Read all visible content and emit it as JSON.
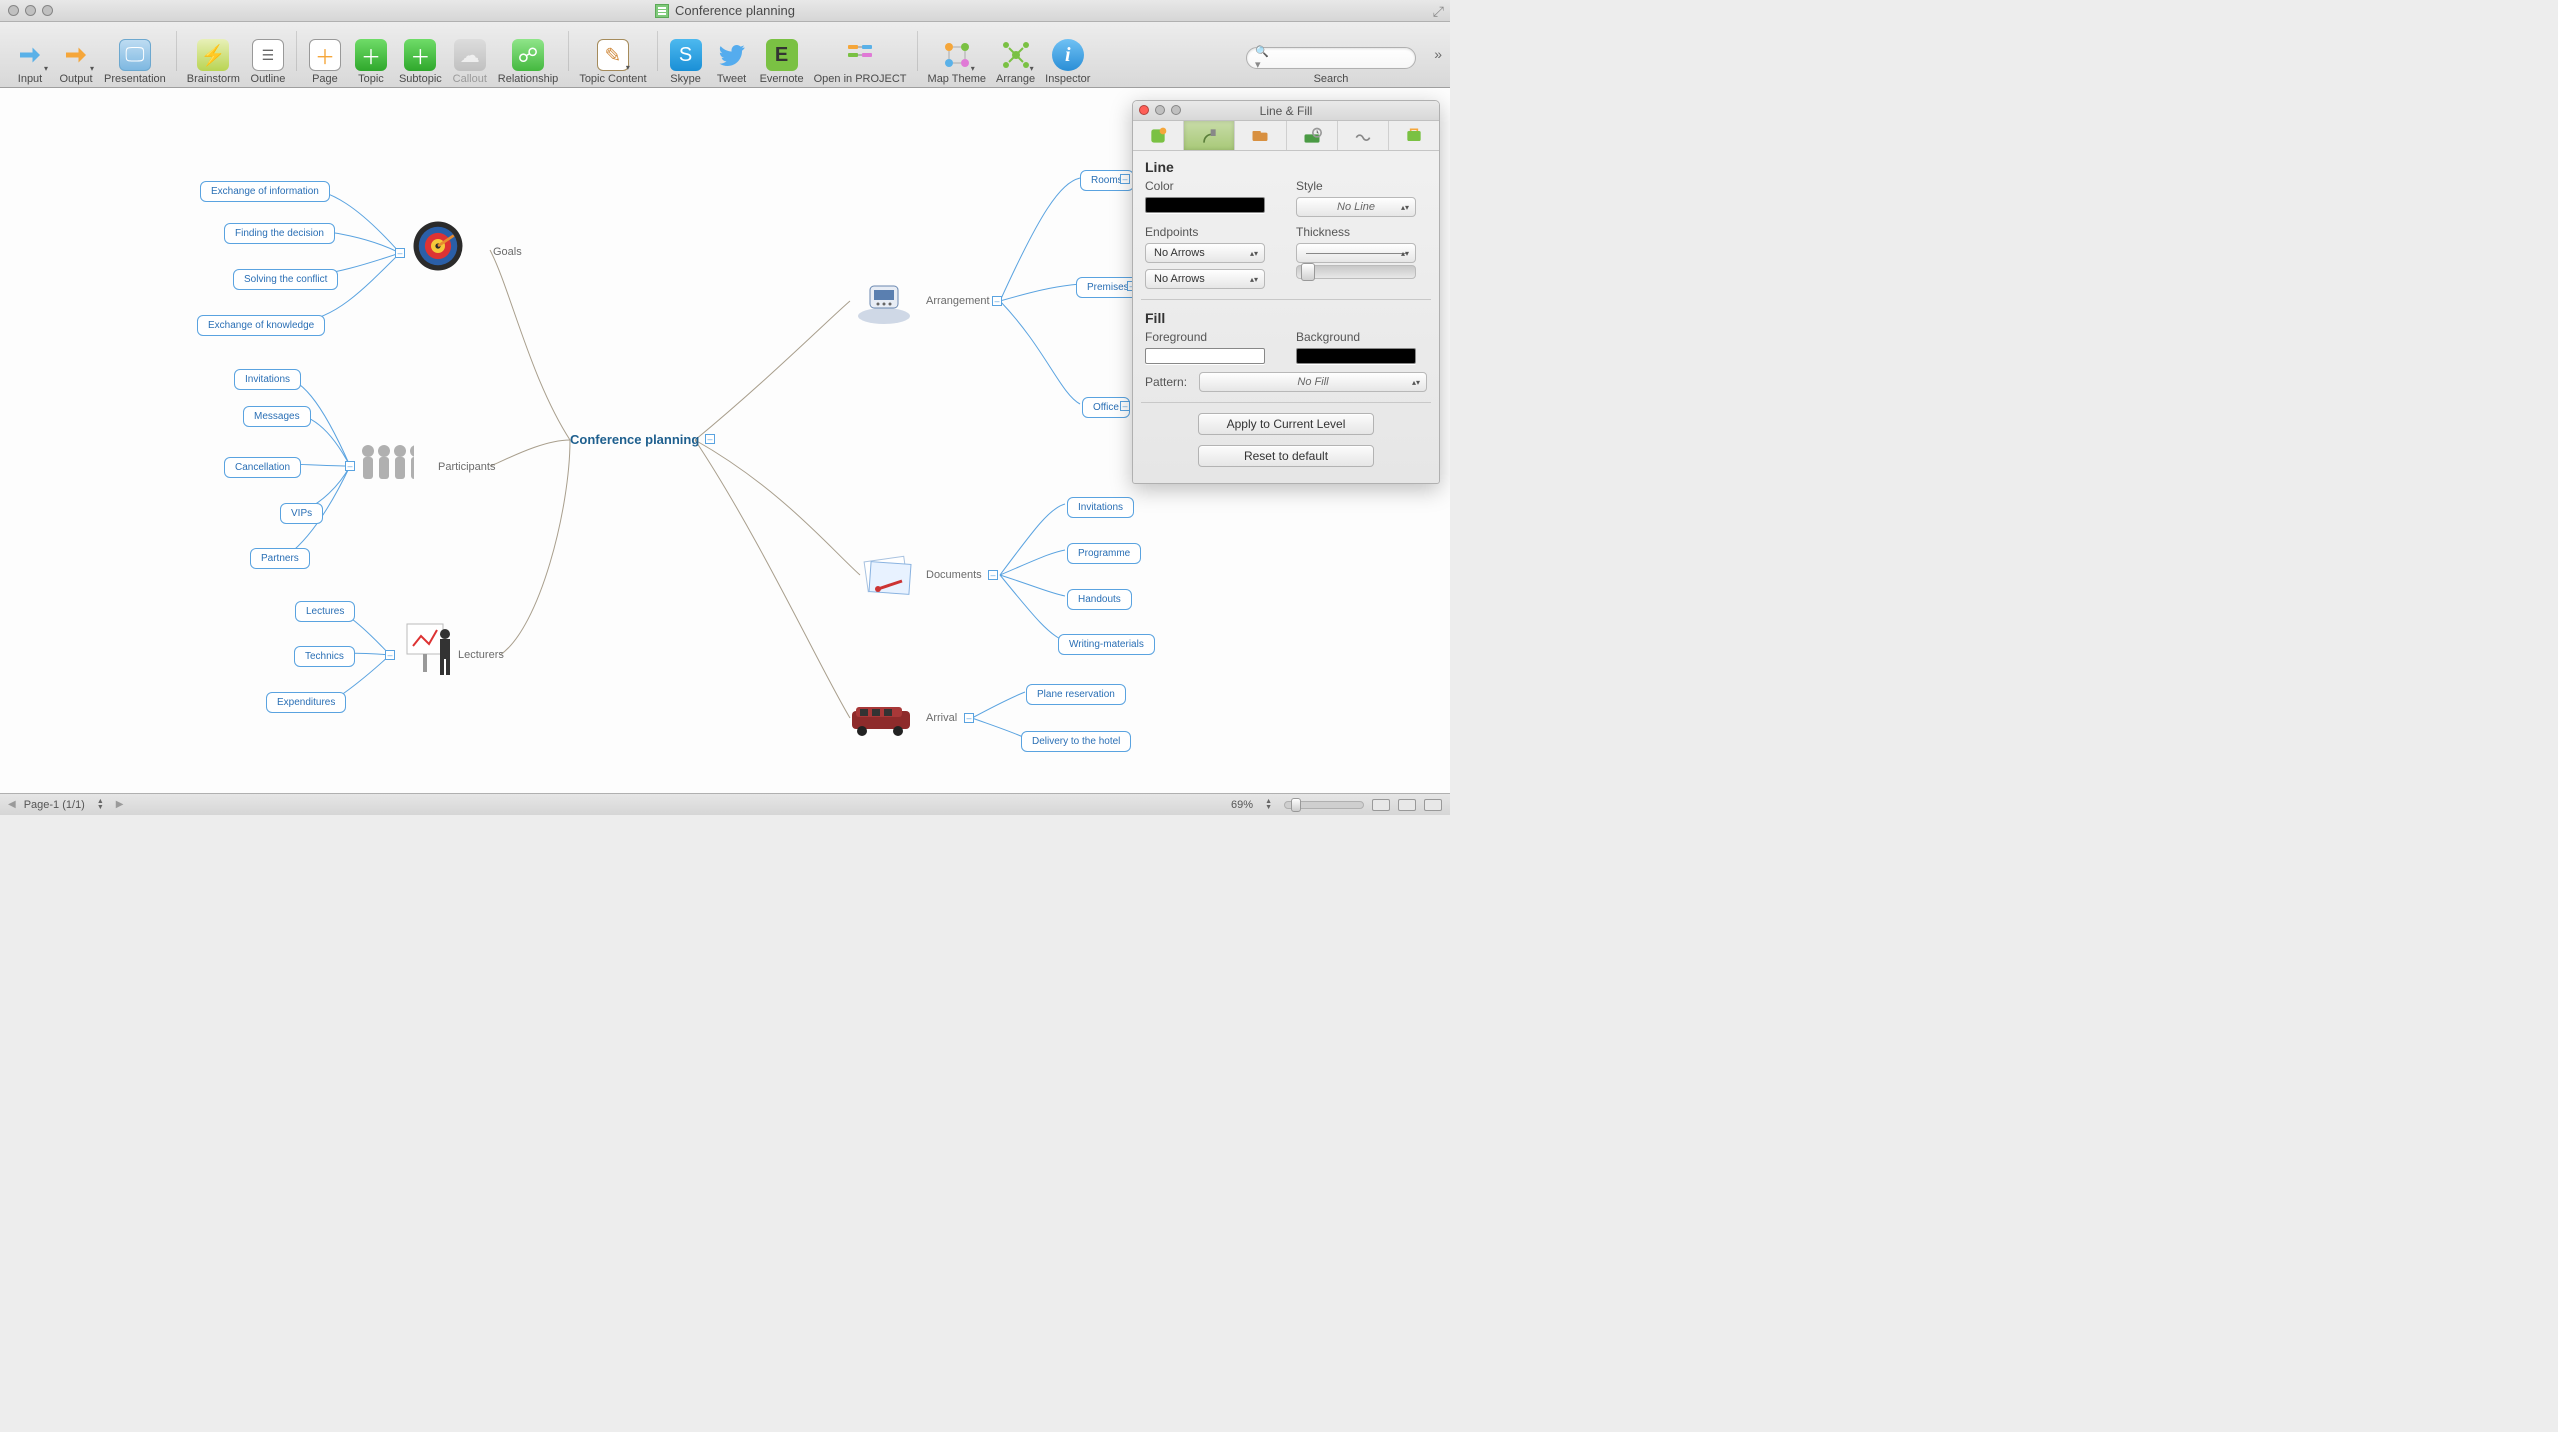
{
  "window": {
    "title": "Conference planning"
  },
  "toolbar": {
    "items": [
      {
        "id": "input",
        "label": "Input"
      },
      {
        "id": "output",
        "label": "Output"
      },
      {
        "id": "presentation",
        "label": "Presentation"
      },
      {
        "id": "brainstorm",
        "label": "Brainstorm"
      },
      {
        "id": "outline",
        "label": "Outline"
      },
      {
        "id": "page",
        "label": "Page"
      },
      {
        "id": "topic",
        "label": "Topic"
      },
      {
        "id": "subtopic",
        "label": "Subtopic"
      },
      {
        "id": "callout",
        "label": "Callout",
        "disabled": true
      },
      {
        "id": "relationship",
        "label": "Relationship"
      },
      {
        "id": "topic-content",
        "label": "Topic Content"
      },
      {
        "id": "skype",
        "label": "Skype"
      },
      {
        "id": "tweet",
        "label": "Tweet"
      },
      {
        "id": "evernote",
        "label": "Evernote"
      },
      {
        "id": "open-in-project",
        "label": "Open in PROJECT"
      },
      {
        "id": "map-theme",
        "label": "Map Theme"
      },
      {
        "id": "arrange",
        "label": "Arrange"
      },
      {
        "id": "inspector",
        "label": "Inspector"
      }
    ],
    "search_label": "Search"
  },
  "mindmap": {
    "central": "Conference planning",
    "left": {
      "goals": {
        "label": "Goals",
        "children": [
          "Exchange of information",
          "Finding the decision",
          "Solving the conflict",
          "Exchange of knowledge"
        ]
      },
      "participants": {
        "label": "Participants",
        "children": [
          "Invitations",
          "Messages",
          "Cancellation",
          "VIPs",
          "Partners"
        ]
      },
      "lecturers": {
        "label": "Lecturers",
        "children": [
          "Lectures",
          "Technics",
          "Expenditures"
        ]
      }
    },
    "right": {
      "arrangement": {
        "label": "Arrangement",
        "children": [
          "Rooms",
          "Premises",
          "Office"
        ]
      },
      "documents": {
        "label": "Documents",
        "children": [
          "Invitations",
          "Programme",
          "Handouts",
          "Writing-materials"
        ]
      },
      "arrival": {
        "label": "Arrival",
        "children": [
          "Plane reservation",
          "Delivery to the hotel"
        ]
      }
    }
  },
  "inspector": {
    "title": "Line & Fill",
    "line": {
      "heading": "Line",
      "color_label": "Color",
      "style_label": "Style",
      "style_value": "No Line",
      "endpoints_label": "Endpoints",
      "thickness_label": "Thickness",
      "endpoint_start": "No Arrows",
      "endpoint_end": "No Arrows"
    },
    "fill": {
      "heading": "Fill",
      "fg_label": "Foreground",
      "bg_label": "Background",
      "pattern_label": "Pattern:",
      "pattern_value": "No Fill"
    },
    "apply": "Apply to Current Level",
    "reset": "Reset to default"
  },
  "statusbar": {
    "page": "Page-1 (1/1)",
    "zoom": "69%"
  },
  "colors": {
    "node_border": "#5aa3e0",
    "accent_green": "#7ac143",
    "skype_blue": "#1a8fd6"
  }
}
